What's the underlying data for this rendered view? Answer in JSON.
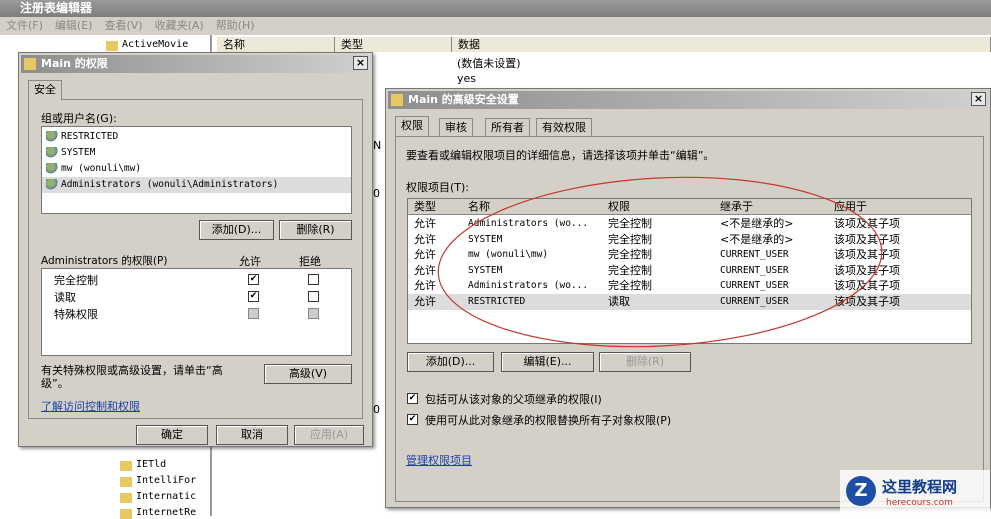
{
  "app": {
    "title": "注册表编辑器",
    "menu": [
      "文件(F)",
      "编辑(E)",
      "查看(V)",
      "收藏夹(A)",
      "帮助(H)"
    ]
  },
  "tree": {
    "items": [
      "ActiveMovie",
      "IETld",
      "IntelliFor",
      "Internatic",
      "InternetRe"
    ]
  },
  "list": {
    "columns": [
      "名称",
      "类型",
      "数据"
    ],
    "values": [
      "(数值未设置)",
      "yes"
    ],
    "clipped": [
      "N",
      "0",
      "0"
    ]
  },
  "perm_dialog": {
    "title": "Main 的权限",
    "close": "×",
    "tab": "安全",
    "group_label": "组或用户名(G):",
    "users": [
      "RESTRICTED",
      "SYSTEM",
      "mw (wonuli\\mw)",
      "Administrators (wonuli\\Administrators)"
    ],
    "add": "添加(D)...",
    "remove": "删除(R)",
    "perm_label": "Administrators 的权限(P)",
    "allow": "允许",
    "deny": "拒绝",
    "perms": [
      {
        "name": "完全控制",
        "allow": true,
        "deny": false
      },
      {
        "name": "读取",
        "allow": true,
        "deny": false
      },
      {
        "name": "特殊权限",
        "allow": false,
        "deny": false
      }
    ],
    "advanced_text": "有关特殊权限或高级设置，请单击“高级”。",
    "advanced": "高级(V)",
    "link": "了解访问控制和权限",
    "ok": "确定",
    "cancel": "取消",
    "apply": "应用(A)"
  },
  "adv_dialog": {
    "title": "Main 的高级安全设置",
    "close": "×",
    "tabs": [
      "权限",
      "审核",
      "所有者",
      "有效权限"
    ],
    "instruction": "要查看或编辑权限项目的详细信息，请选择该项并单击“编辑”。",
    "entries_label": "权限项目(T):",
    "columns": [
      "类型",
      "名称",
      "权限",
      "继承于",
      "应用于"
    ],
    "rows": [
      [
        "允许",
        "Administrators (wo...",
        "完全控制",
        "<不是继承的>",
        "该项及其子项"
      ],
      [
        "允许",
        "SYSTEM",
        "完全控制",
        "<不是继承的>",
        "该项及其子项"
      ],
      [
        "允许",
        "mw (wonuli\\mw)",
        "完全控制",
        "CURRENT_USER",
        "该项及其子项"
      ],
      [
        "允许",
        "SYSTEM",
        "完全控制",
        "CURRENT_USER",
        "该项及其子项"
      ],
      [
        "允许",
        "Administrators (wo...",
        "完全控制",
        "CURRENT_USER",
        "该项及其子项"
      ],
      [
        "允许",
        "RESTRICTED",
        "读取",
        "CURRENT_USER",
        "该项及其子项"
      ]
    ],
    "add": "添加(D)...",
    "edit": "编辑(E)...",
    "remove": "删除(R)",
    "check1": "包括可从该对象的父项继承的权限(I)",
    "check2": "使用可从此对象继承的权限替换所有子对象权限(P)",
    "link": "管理权限项目"
  },
  "watermark": {
    "text": "这里教程网",
    "url": "herecours.com"
  }
}
